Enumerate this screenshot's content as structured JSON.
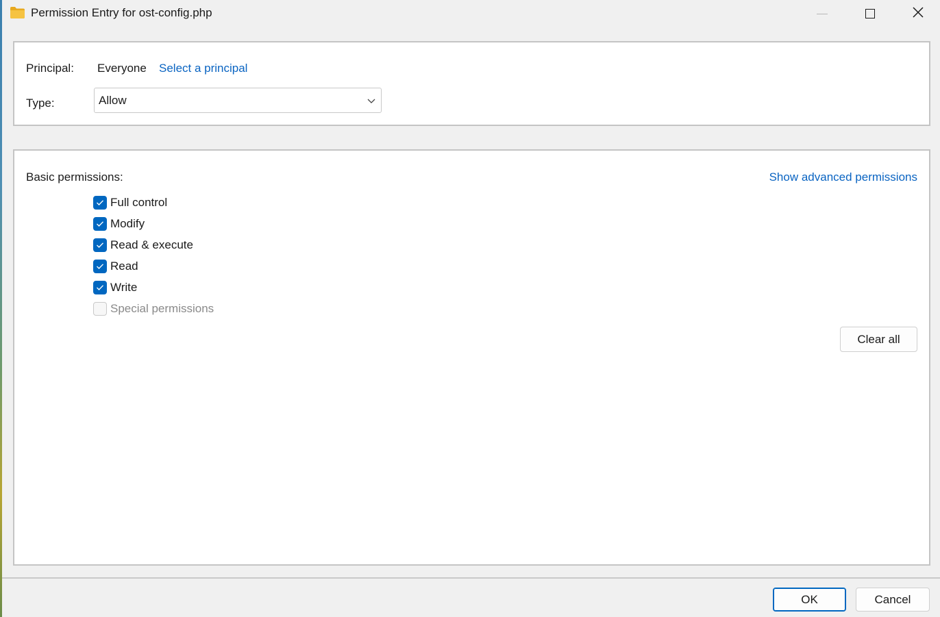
{
  "window": {
    "title": "Permission Entry for ost-config.php",
    "icon": "folder-icon"
  },
  "principal": {
    "label": "Principal:",
    "value": "Everyone",
    "link": "Select a principal"
  },
  "type": {
    "label": "Type:",
    "selected": "Allow"
  },
  "permissions": {
    "heading": "Basic permissions:",
    "advanced_link": "Show advanced permissions",
    "items": [
      {
        "label": "Full control",
        "checked": true,
        "enabled": true
      },
      {
        "label": "Modify",
        "checked": true,
        "enabled": true
      },
      {
        "label": "Read & execute",
        "checked": true,
        "enabled": true
      },
      {
        "label": "Read",
        "checked": true,
        "enabled": true
      },
      {
        "label": "Write",
        "checked": true,
        "enabled": true
      },
      {
        "label": "Special permissions",
        "checked": false,
        "enabled": false
      }
    ],
    "clear_all": "Clear all"
  },
  "footer": {
    "ok": "OK",
    "cancel": "Cancel"
  },
  "colors": {
    "accent": "#0067c0",
    "link": "#0a64c2",
    "folder": "#f6c342"
  }
}
